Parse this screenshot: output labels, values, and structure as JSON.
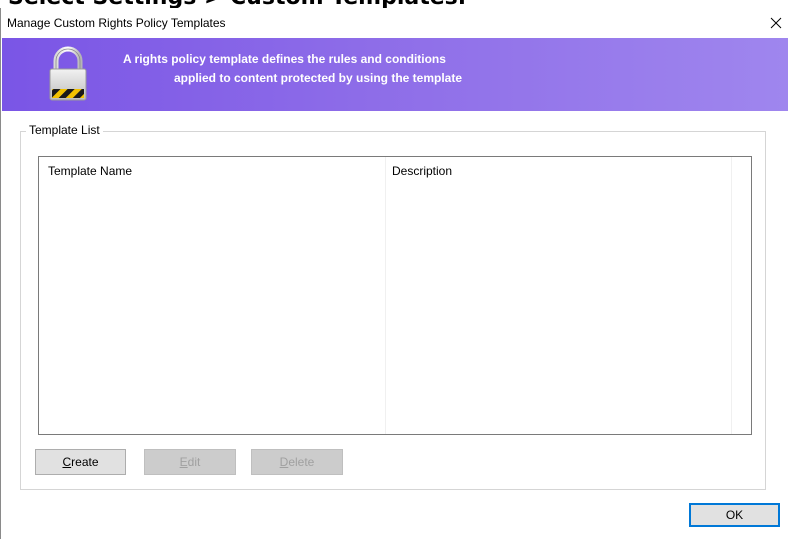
{
  "page_heading_cut": "Select Settings > Custom Templates.",
  "window": {
    "title": "Manage Custom Rights Policy Templates",
    "close_icon": "close-icon"
  },
  "banner": {
    "icon": "lock-icon",
    "line1": "A rights policy template defines the rules and conditions",
    "line2": "applied to content protected by using the template",
    "gradient_start": "#7a55e6",
    "gradient_end": "#9f86ee"
  },
  "template_list": {
    "label": "Template List",
    "columns": [
      "Template Name",
      "Description"
    ],
    "rows": []
  },
  "buttons": {
    "create": {
      "accel": "C",
      "rest": "reate",
      "enabled": true
    },
    "edit": {
      "accel": "E",
      "rest": "dit",
      "enabled": false
    },
    "delete": {
      "accel": "D",
      "rest": "elete",
      "enabled": false
    },
    "ok": "OK"
  },
  "colors": {
    "focus_border": "#0078d7"
  }
}
